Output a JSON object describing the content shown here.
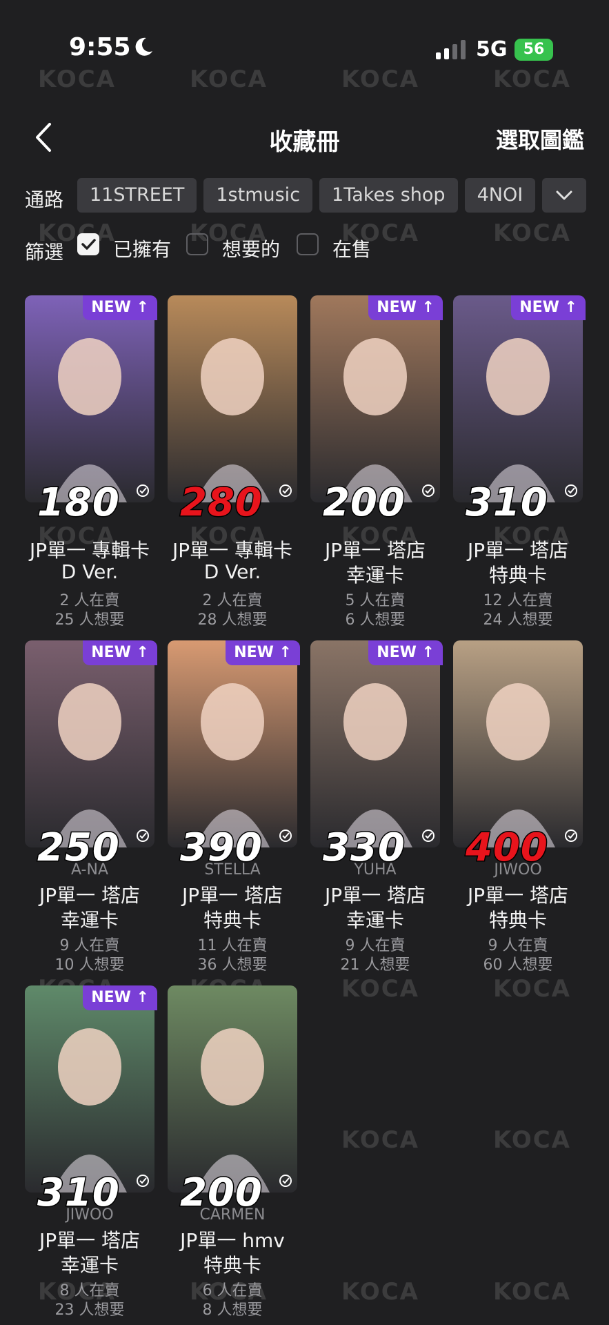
{
  "status_bar": {
    "time": "9:55",
    "network": "5G",
    "battery": "56"
  },
  "nav": {
    "title": "收藏冊",
    "action": "選取圖鑑"
  },
  "channel": {
    "label": "通路",
    "chips": [
      "11STREET",
      "1stmusic",
      "1Takes shop",
      "4NOI"
    ]
  },
  "filter": {
    "label": "篩選",
    "options": [
      {
        "label": "已擁有",
        "checked": true
      },
      {
        "label": "想要的",
        "checked": false
      },
      {
        "label": "在售",
        "checked": false
      }
    ]
  },
  "watermark": "KOCA",
  "cards": [
    {
      "price": "180",
      "price_color": "#ffffff",
      "is_new": true,
      "new_label": "NEW ↑",
      "member": "",
      "line1": "JP單一 專輯卡",
      "line2": "D Ver.",
      "selling": "2 人在賣",
      "wanting": "25 人想要",
      "photo_color": "#7e62b8"
    },
    {
      "price": "280",
      "price_color": "#e8141c",
      "is_new": false,
      "new_label": "",
      "member": "",
      "line1": "JP單一 專輯卡",
      "line2": "D Ver.",
      "selling": "2 人在賣",
      "wanting": "28 人想要",
      "photo_color": "#b88a5a"
    },
    {
      "price": "200",
      "price_color": "#ffffff",
      "is_new": true,
      "new_label": "NEW ↑",
      "member": "",
      "line1": "JP單一 塔店",
      "line2": "幸運卡",
      "selling": "5 人在賣",
      "wanting": "6 人想要",
      "photo_color": "#a0785c"
    },
    {
      "price": "310",
      "price_color": "#ffffff",
      "is_new": true,
      "new_label": "NEW ↑",
      "member": "",
      "line1": "JP單一 塔店",
      "line2": "特典卡",
      "selling": "12 人在賣",
      "wanting": "24 人想要",
      "photo_color": "#6a5a8a"
    },
    {
      "price": "250",
      "price_color": "#ffffff",
      "is_new": true,
      "new_label": "NEW ↑",
      "member": "A-NA",
      "line1": "JP單一 塔店",
      "line2": "幸運卡",
      "selling": "9 人在賣",
      "wanting": "10 人想要",
      "photo_color": "#7a5f6e"
    },
    {
      "price": "390",
      "price_color": "#ffffff",
      "is_new": true,
      "new_label": "NEW ↑",
      "member": "STELLA",
      "line1": "JP單一 塔店",
      "line2": "特典卡",
      "selling": "11 人在賣",
      "wanting": "36 人想要",
      "photo_color": "#d89a72"
    },
    {
      "price": "330",
      "price_color": "#ffffff",
      "is_new": true,
      "new_label": "NEW ↑",
      "member": "YUHA",
      "line1": "JP單一 塔店",
      "line2": "幸運卡",
      "selling": "9 人在賣",
      "wanting": "21 人想要",
      "photo_color": "#8a7466"
    },
    {
      "price": "400",
      "price_color": "#e8141c",
      "is_new": false,
      "new_label": "",
      "member": "JIWOO",
      "line1": "JP單一 塔店",
      "line2": "特典卡",
      "selling": "9 人在賣",
      "wanting": "60 人想要",
      "photo_color": "#b8a084"
    },
    {
      "price": "310",
      "price_color": "#ffffff",
      "is_new": true,
      "new_label": "NEW ↑",
      "member": "JIWOO",
      "line1": "JP單一 塔店",
      "line2": "幸運卡",
      "selling": "8 人在賣",
      "wanting": "23 人想要",
      "photo_color": "#5f8a6a"
    },
    {
      "price": "200",
      "price_color": "#ffffff",
      "is_new": false,
      "new_label": "",
      "member": "CARMEN",
      "line1": "JP單一 hmv",
      "line2": "特典卡",
      "selling": "6 人在賣",
      "wanting": "8 人想要",
      "photo_color": "#6e8a62"
    }
  ]
}
